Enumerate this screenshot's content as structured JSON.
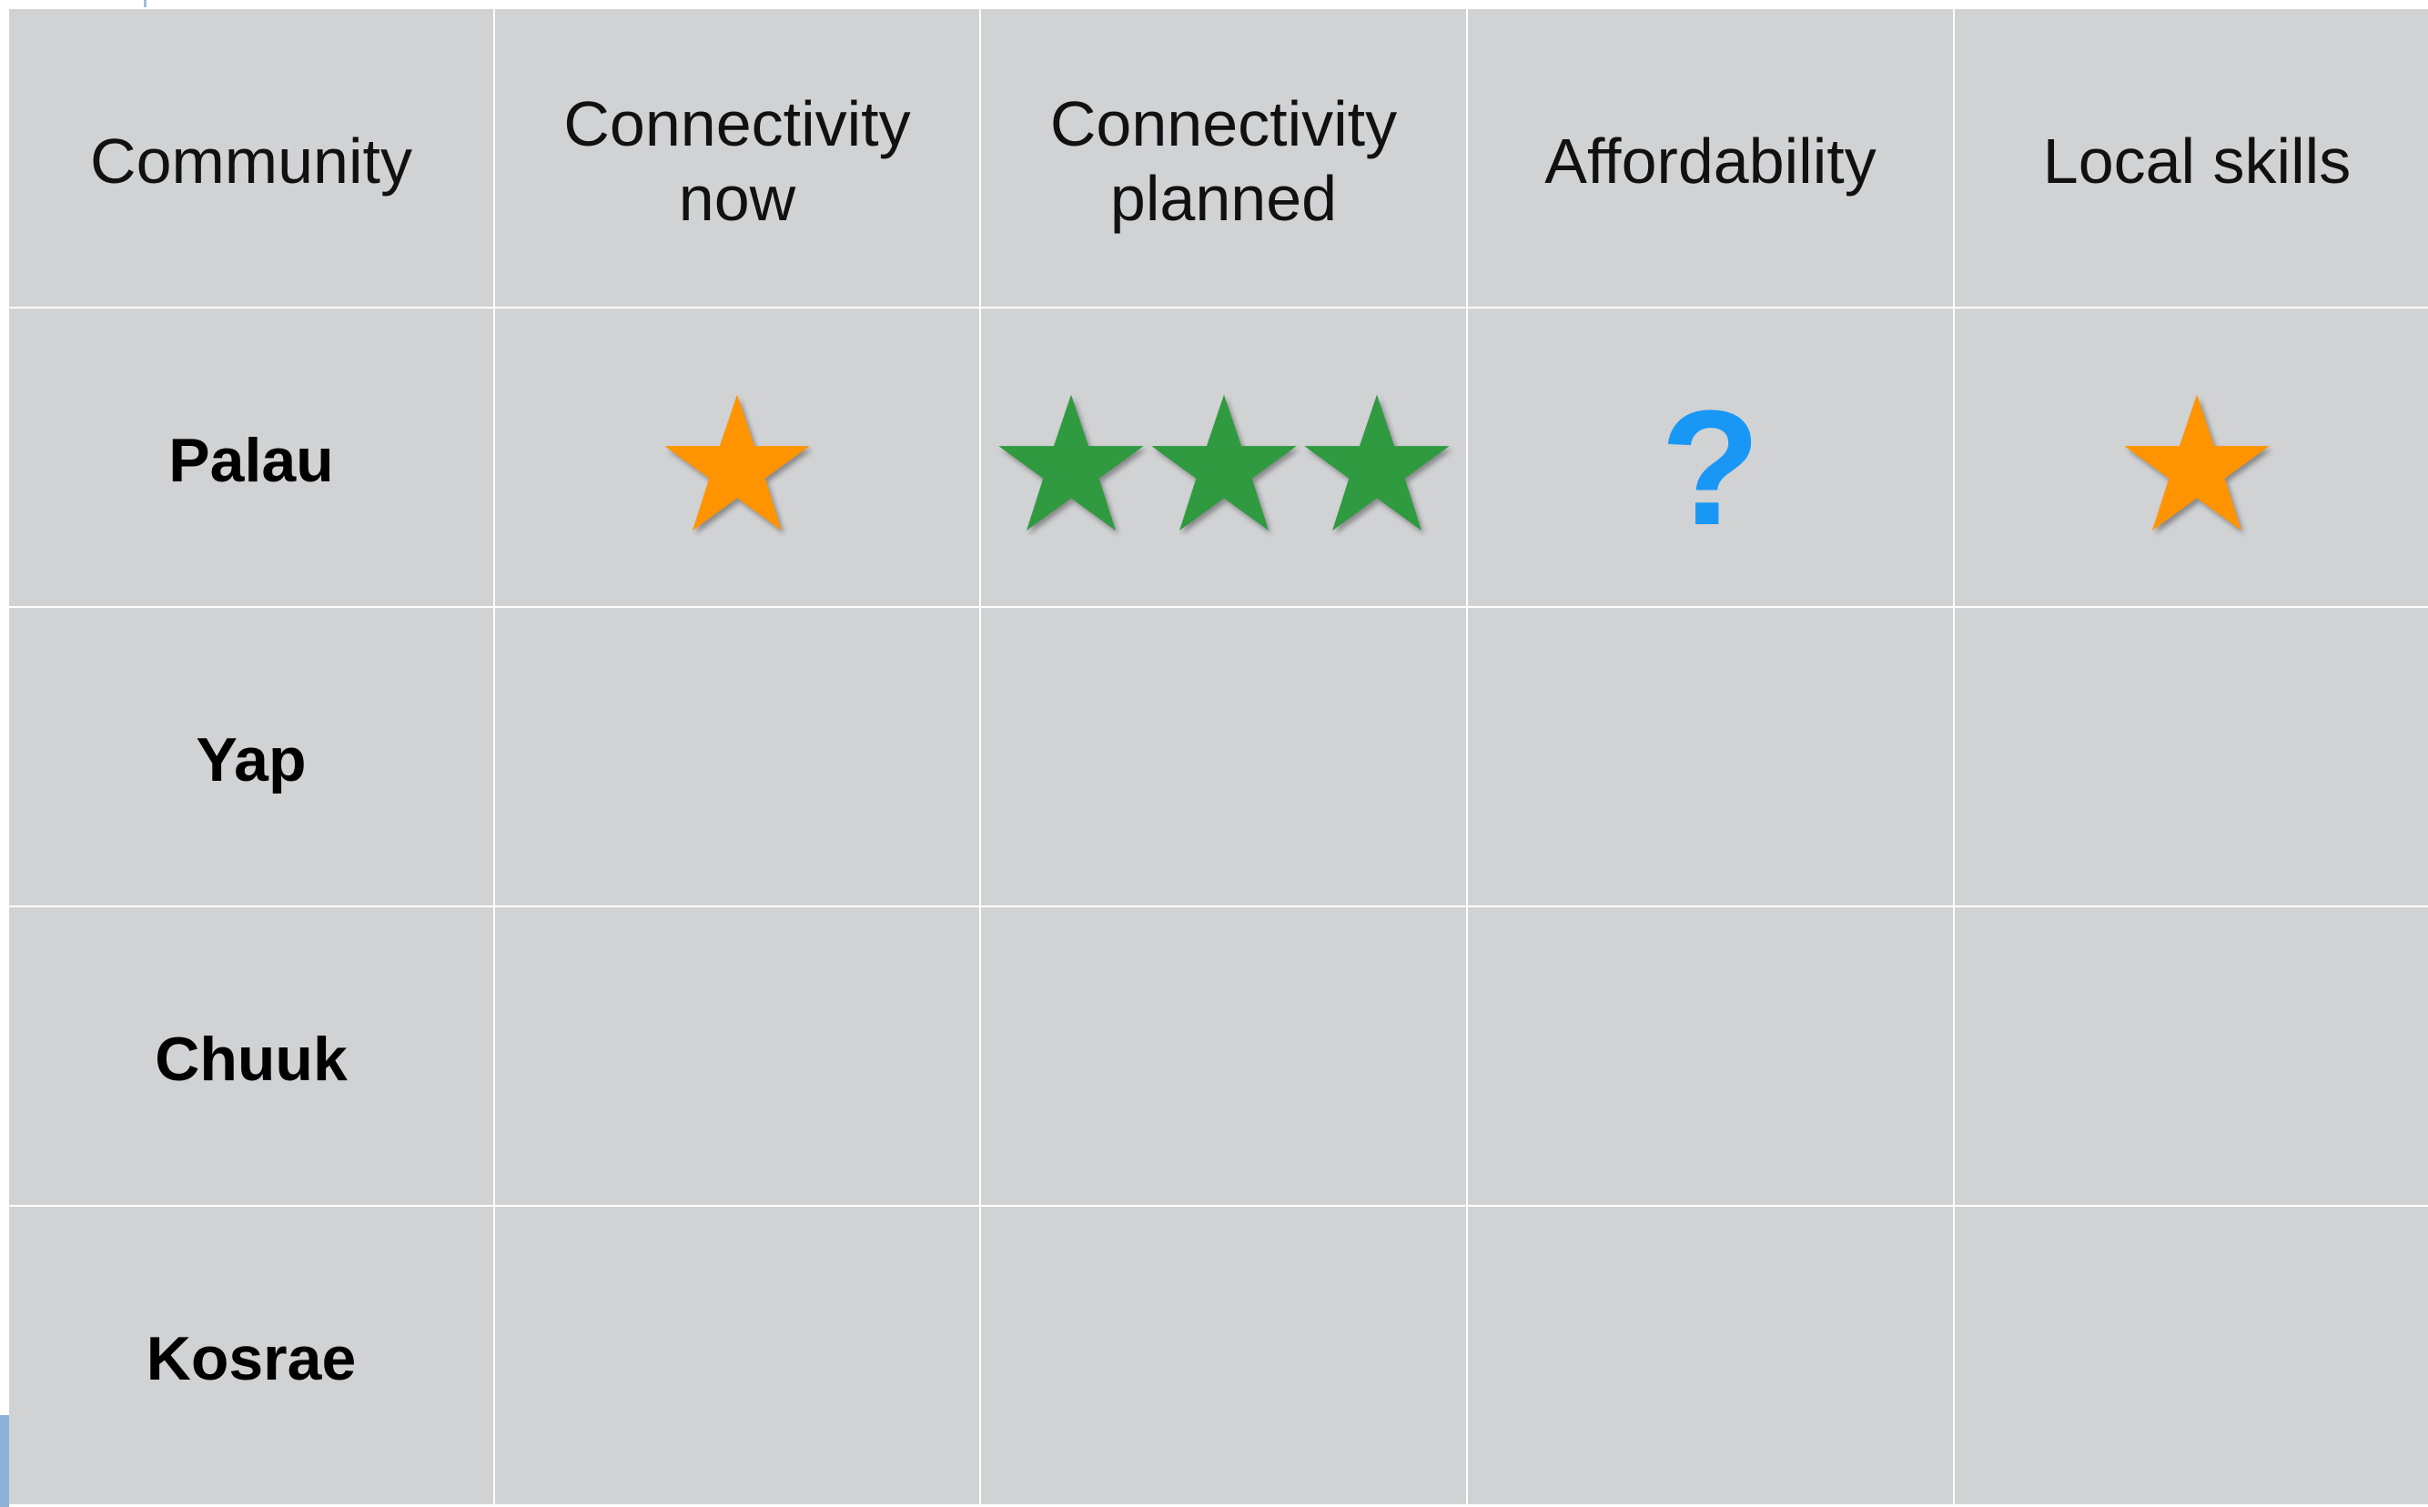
{
  "table": {
    "headers": [
      "Community",
      "Connectivity now",
      "Connectivity planned",
      "Affordability",
      "Local skills"
    ],
    "rows": [
      {
        "community": "Palau",
        "ratings": [
          {
            "kind": "stars",
            "count": 1,
            "color": "#ff9400"
          },
          {
            "kind": "stars",
            "count": 3,
            "color": "#2f9a3f"
          },
          {
            "kind": "unknown",
            "symbol": "?",
            "color": "#1997f5"
          },
          {
            "kind": "stars",
            "count": 1,
            "color": "#ff9400"
          }
        ]
      },
      {
        "community": "Yap",
        "ratings": []
      },
      {
        "community": "Chuuk",
        "ratings": []
      },
      {
        "community": "Kosrae",
        "ratings": []
      }
    ]
  },
  "colors": {
    "cell_background": "#d1d2d4",
    "grid_line": "#ffffff",
    "star_orange": "#ff9400",
    "star_green": "#2f9a3f",
    "question_blue": "#1997f5"
  },
  "icons": {
    "star": "star-icon",
    "unknown": "question-mark-icon"
  }
}
